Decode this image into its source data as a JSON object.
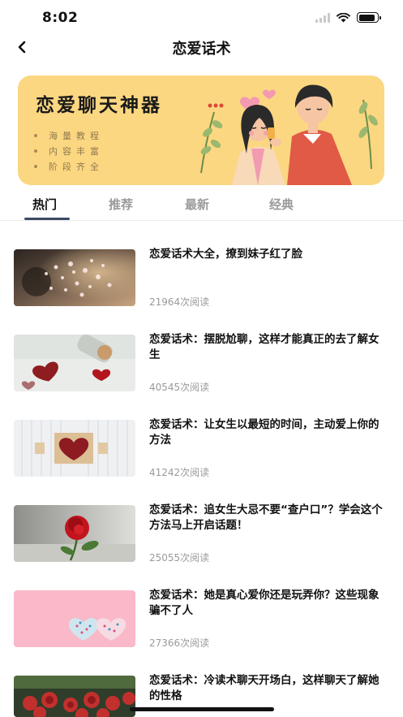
{
  "status_bar": {
    "time": "8:02",
    "battery_level": 0.9
  },
  "nav": {
    "title": "恋爱话术",
    "back_icon": "chevron-left-icon"
  },
  "banner": {
    "title": "恋爱聊天神器",
    "features": [
      "海量教程",
      "内容丰富",
      "阶段齐全"
    ],
    "background": "#fcd781"
  },
  "tabs": [
    {
      "label": "热门",
      "active": true
    },
    {
      "label": "推荐",
      "active": false
    },
    {
      "label": "最新",
      "active": false
    },
    {
      "label": "经典",
      "active": false
    }
  ],
  "articles": [
    {
      "title": "恋爱话术大全，撩到妹子红了脸",
      "reads": "21964次阅读",
      "thumb": "hearts-bokeh"
    },
    {
      "title": "恋爱话术：摆脱尬聊，这样才能真正的去了解女生",
      "reads": "40545次阅读",
      "thumb": "heart-bottle"
    },
    {
      "title": "恋爱话术：让女生以最短的时间，主动爱上你的方法",
      "reads": "41242次阅读",
      "thumb": "i-heart-u"
    },
    {
      "title": "恋爱话术：追女生大忌不要“查户口”？学会这个方法马上开启话题！",
      "reads": "25055次阅读",
      "thumb": "red-rose"
    },
    {
      "title": "恋爱话术：她是真心爱你还是玩弄你？这些现象骗不了人",
      "reads": "27366次阅读",
      "thumb": "pink-hearts"
    },
    {
      "title": "恋爱话术：冷读术聊天开场白，这样聊天了解她的性格",
      "reads": "",
      "thumb": "roses"
    }
  ],
  "colors": {
    "accent": "#3c4a63",
    "muted": "#9a9a9a"
  }
}
